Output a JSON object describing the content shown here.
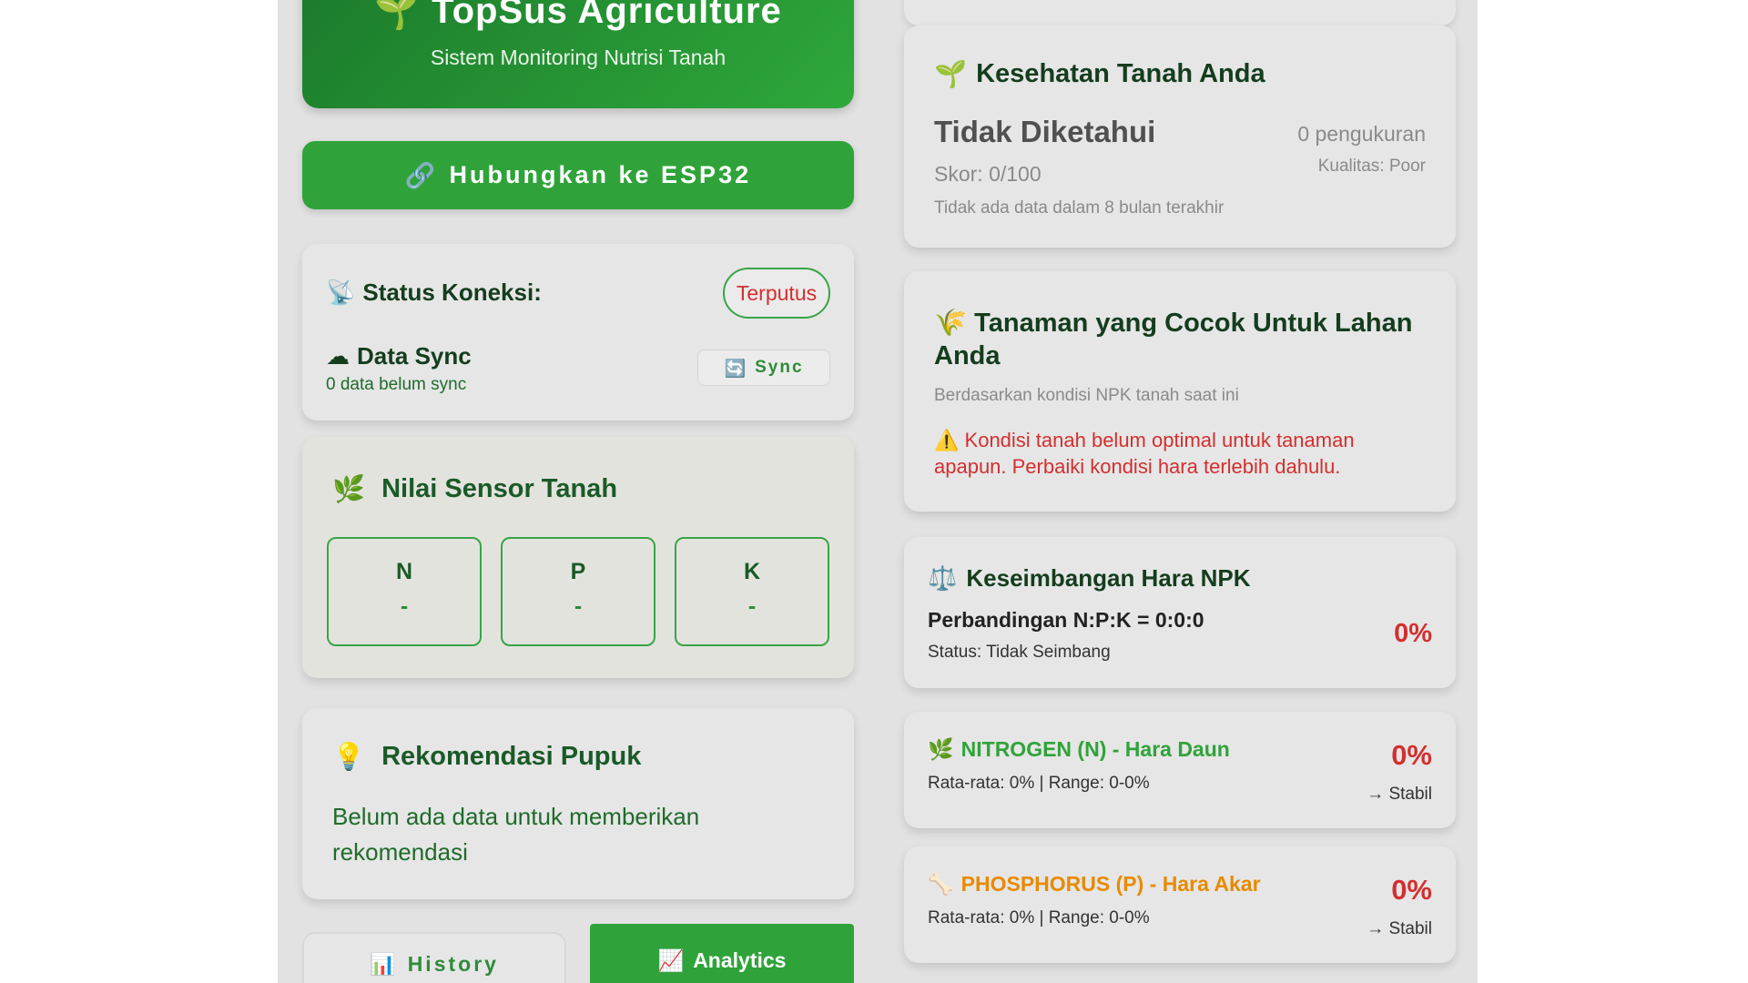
{
  "header": {
    "icon": "seedling-icon",
    "title": "TopSus Agriculture",
    "subtitle": "Sistem Monitoring Nutrisi Tanah"
  },
  "connect_button": {
    "icon": "link-icon",
    "label": "Hubungkan ke ESP32"
  },
  "connection": {
    "label": "Status Koneksi:",
    "status": "Terputus",
    "sync_label": "Data Sync",
    "sync_sub": "0 data belum sync",
    "sync_button": "Sync"
  },
  "sensor": {
    "title": "Nilai Sensor Tanah",
    "items": [
      {
        "name": "N",
        "value": "-"
      },
      {
        "name": "P",
        "value": "-"
      },
      {
        "name": "K",
        "value": "-"
      }
    ]
  },
  "recommendation": {
    "title": "Rekomendasi Pupuk",
    "text": "Belum ada data untuk memberikan rekomendasi"
  },
  "tabs": [
    {
      "label": "History",
      "icon": "bar-chart-icon",
      "active": false
    },
    {
      "label": "Analytics",
      "icon": "trend-up-icon",
      "active": true
    }
  ],
  "soil_health": {
    "title": "Kesehatan Tanah Anda",
    "status": "Tidak Diketahui",
    "score": "Skor: 0/100",
    "note": "Tidak ada data dalam 8 bulan terakhir",
    "count": "0 pengukuran",
    "quality": "Kualitas: Poor"
  },
  "suitable_plants": {
    "title": "Tanaman yang Cocok Untuk Lahan Anda",
    "subtitle": "Berdasarkan kondisi NPK tanah saat ini",
    "warning": "Kondisi tanah belum optimal untuk tanaman apapun. Perbaiki kondisi hara terlebih dahulu."
  },
  "npk_balance": {
    "title": "Keseimbangan Hara NPK",
    "ratio": "Perbandingan N:P:K = 0:0:0",
    "status": "Status: Tidak Seimbang",
    "percent": "0%"
  },
  "nutrients": [
    {
      "title": "NITROGEN (N) - Hara Daun",
      "avg": "Rata-rata: 0% | Range: 0-0%",
      "percent": "0%",
      "trend": "→ Stabil",
      "icon": "herb-icon"
    },
    {
      "title": "PHOSPHORUS (P) - Hara Akar",
      "avg": "Rata-rata: 0% | Range: 0-0%",
      "percent": "0%",
      "trend": "→ Stabil",
      "icon": "bone-icon"
    }
  ],
  "colors": {
    "primary_green": "#2fa33a",
    "dark_green": "#1a5a28",
    "danger_red": "#d32f2f",
    "phosphorus_orange": "#e88a00",
    "background": "#e2e2e2"
  }
}
